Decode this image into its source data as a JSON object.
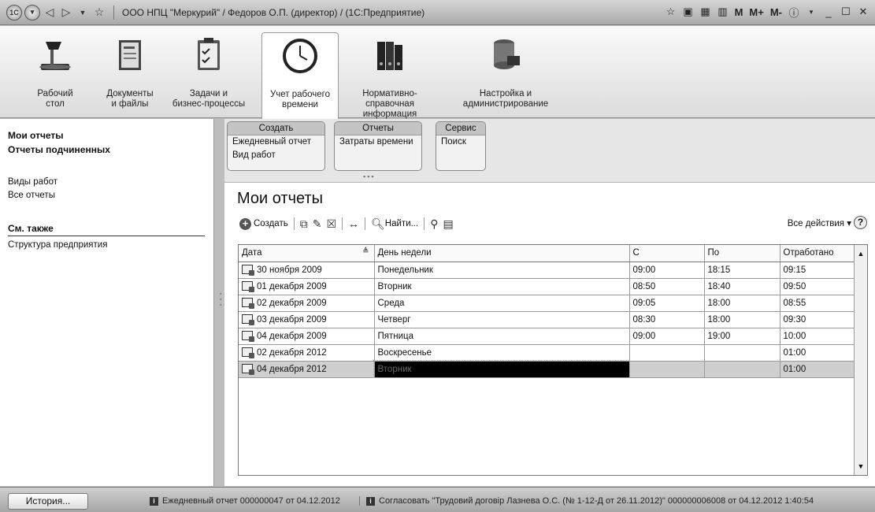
{
  "window": {
    "title": "ООО НПЦ \"Меркурий\" / Федоров О.П. (директор) / (1С:Предприятие)",
    "right_labels": [
      "M",
      "M+",
      "M-"
    ]
  },
  "sections": [
    {
      "label": "Рабочий\nстол",
      "icon": "desk-lamp-icon"
    },
    {
      "label": "Документы\nи файлы",
      "icon": "documents-icon"
    },
    {
      "label": "Задачи и\nбизнес-процессы",
      "icon": "tasks-clipboard-icon"
    },
    {
      "label": "Учет рабочего\nвремени",
      "icon": "clock-icon",
      "active": true
    },
    {
      "label": "Нормативно-справочная\nинформация",
      "icon": "binders-icon"
    },
    {
      "label": "Настройка и\nадминистрирование",
      "icon": "database-icon"
    }
  ],
  "sidebar": {
    "my_reports": "Мои отчеты",
    "sub_reports": "Отчеты подчиненных",
    "work_types": "Виды работ",
    "all_reports": "Все отчеты",
    "see_also": "См. также",
    "structure": "Структура предприятия"
  },
  "command_groups": {
    "create": {
      "title": "Создать",
      "items": [
        "Ежедневный отчет",
        "Вид работ"
      ]
    },
    "reports": {
      "title": "Отчеты",
      "items": [
        "Затраты времени"
      ]
    },
    "service": {
      "title": "Сервис",
      "items": [
        "Поиск"
      ]
    }
  },
  "page": {
    "title": "Мои отчеты"
  },
  "toolbar": {
    "create": "Создать",
    "find": "Найти...",
    "all_actions": "Все действия ▾",
    "help": "?"
  },
  "table": {
    "headers": [
      "Дата",
      "День недели",
      "С",
      "По",
      "Отработано"
    ],
    "rows": [
      [
        "30 ноября 2009",
        "Понедельник",
        "09:00",
        "18:15",
        "09:15"
      ],
      [
        "01 декабря 2009",
        "Вторник",
        "08:50",
        "18:40",
        "09:50"
      ],
      [
        "02 декабря 2009",
        "Среда",
        "09:05",
        "18:00",
        "08:55"
      ],
      [
        "03 декабря 2009",
        "Четверг",
        "08:30",
        "18:00",
        "09:30"
      ],
      [
        "04 декабря 2009",
        "Пятница",
        "09:00",
        "19:00",
        "10:00"
      ],
      [
        "02 декабря 2012",
        "Воскресенье",
        "",
        "",
        "01:00"
      ],
      [
        "04 декабря 2012",
        "Вторник",
        "",
        "",
        "01:00"
      ]
    ],
    "selected_row": 6
  },
  "status": {
    "history": "История...",
    "msg1": "Ежедневный отчет 000000047 от 04.12.2012",
    "msg2": "Согласовать \"Трудовий договір Лазнева О.С. (№ 1-12-Д от 26.11.2012)\" 000000006008 от 04.12.2012 1:40:54"
  }
}
